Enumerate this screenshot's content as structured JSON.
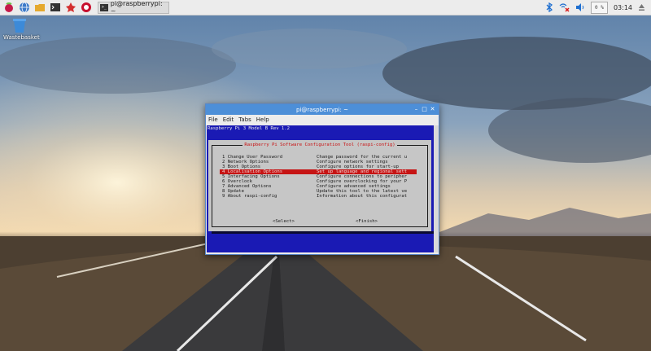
{
  "taskbar": {
    "launchers": [
      {
        "icon": "raspberry-menu-icon"
      },
      {
        "icon": "web-browser-icon"
      },
      {
        "icon": "file-manager-icon"
      },
      {
        "icon": "terminal-icon"
      },
      {
        "icon": "mathematica-icon"
      },
      {
        "icon": "wolfram-icon"
      }
    ],
    "task": {
      "icon": "terminal-icon",
      "label": "pi@raspberrypi: ~"
    },
    "tray": {
      "bluetooth_icon": "bluetooth-icon",
      "network_icon": "wifi-disconnected-icon",
      "volume_icon": "volume-icon",
      "cpu_label": "0 %",
      "clock": "03:14",
      "eject_icon": "eject-icon"
    }
  },
  "desktop": {
    "icons": [
      {
        "icon": "wastebasket-icon",
        "label": "Wastebasket"
      }
    ]
  },
  "window": {
    "title": "pi@raspberrypi: ~",
    "menu": [
      "File",
      "Edit",
      "Tabs",
      "Help"
    ],
    "terminal": {
      "header": "Raspberry Pi 3 Model B Rev 1.2",
      "dialog_title": "Raspberry Pi Software Configuration Tool (raspi-config)",
      "options": [
        {
          "name": "1 Change User Password",
          "desc": "Change password for the current u"
        },
        {
          "name": "2 Network Options",
          "desc": "Configure network settings"
        },
        {
          "name": "3 Boot Options",
          "desc": "Configure options for start-up"
        },
        {
          "name": "4 Localisation Options",
          "desc": "Set up language and regional sett",
          "selected": true
        },
        {
          "name": "5 Interfacing Options",
          "desc": "Configure connections to peripher"
        },
        {
          "name": "6 Overclock",
          "desc": "Configure overclocking for your P"
        },
        {
          "name": "7 Advanced Options",
          "desc": "Configure advanced settings"
        },
        {
          "name": "8 Update",
          "desc": "Update this tool to the latest ve"
        },
        {
          "name": "9 About raspi-config",
          "desc": "Information about this configurat"
        }
      ],
      "select_button": "<Select>",
      "finish_button": "<Finish>"
    }
  },
  "colors": {
    "terminal_bg": "#1a1ab4",
    "dialog_bg": "#c6c6c6",
    "highlight": "#c61414",
    "titlebar": "#4d8fd8"
  }
}
